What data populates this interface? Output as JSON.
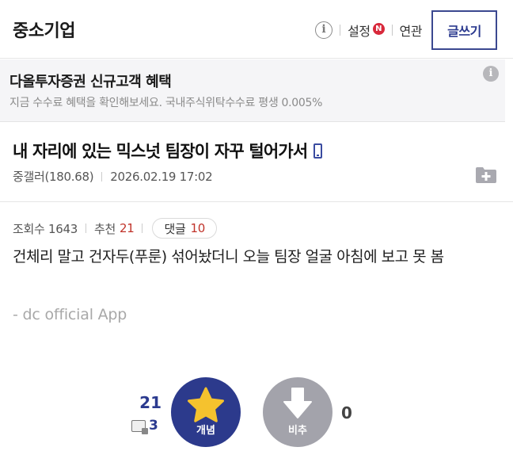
{
  "header": {
    "gallery_title": "중소기업",
    "settings_label": "설정",
    "new_badge": "N",
    "related_label": "연관",
    "write_label": "글쓰기",
    "info_glyph": "i"
  },
  "ad": {
    "title": "다올투자증권 신규고객 혜택",
    "description": "지금 수수료 혜택을 확인해보세요. 국내주식위탁수수료 평생 0.005%",
    "info_glyph": "i"
  },
  "post": {
    "title": "내 자리에 있는 믹스넛 팀장이 자꾸 털어가서",
    "author": "중갤러(180.68)",
    "datetime": "2026.02.19 17:02",
    "views_label": "조회수 1643",
    "recommend_label": "추천",
    "recommend_count": "21",
    "comments_label": "댓글",
    "comments_count": "10",
    "body": "건체리 말고 건자두(푸룬) 섞어놨더니 오늘 팀장 얼굴 아침에 보고 못 봄",
    "signature": "- dc official App"
  },
  "vote": {
    "up_count": "21",
    "fixed_count": "3",
    "up_label": "개념",
    "down_label": "비추",
    "down_count": "0",
    "up_color": "#2c3a8c",
    "down_color": "#a3a3ab",
    "star_color": "#f5c22e"
  }
}
